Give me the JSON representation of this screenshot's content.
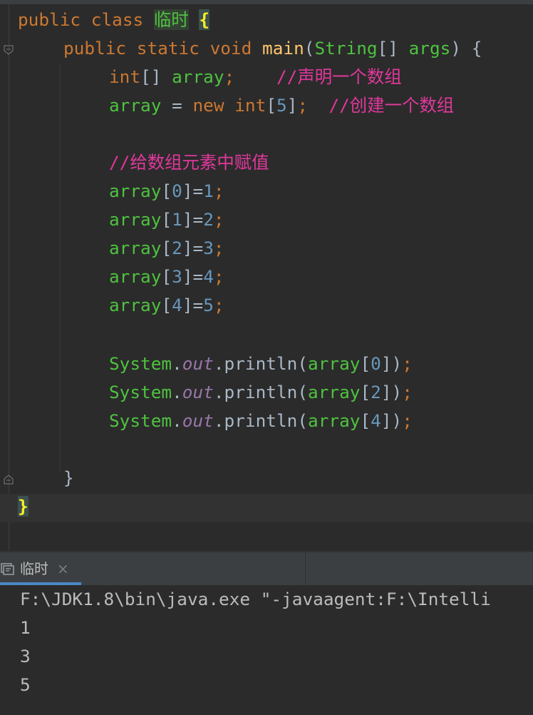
{
  "editor": {
    "line1": {
      "kw": "public class ",
      "class_name": "临时",
      "brace": "{"
    },
    "line2": {
      "modifiers": "public static void ",
      "method": "main",
      "open": "(",
      "param_type": "String",
      "brackets": "[] ",
      "param": "args",
      "close": ") {"
    },
    "line3": {
      "type": "int",
      "brackets": "[] ",
      "var": "array",
      "semi": ";",
      "comment": "//声明一个数组"
    },
    "line4": {
      "var": "array",
      "eq": " = ",
      "kw_new": "new ",
      "type": "int",
      "idx": "5",
      "semi": ";",
      "comment": "//创建一个数组"
    },
    "line6": {
      "comment": "//给数组元素中赋值"
    },
    "assignments": [
      {
        "var": "array",
        "index": "0",
        "value": "1"
      },
      {
        "var": "array",
        "index": "1",
        "value": "2"
      },
      {
        "var": "array",
        "index": "2",
        "value": "3"
      },
      {
        "var": "array",
        "index": "3",
        "value": "4"
      },
      {
        "var": "array",
        "index": "4",
        "value": "5"
      }
    ],
    "prints": [
      {
        "cls": "System",
        "field": "out",
        "method": "println",
        "var": "array",
        "index": "0"
      },
      {
        "cls": "System",
        "field": "out",
        "method": "println",
        "var": "array",
        "index": "2"
      },
      {
        "cls": "System",
        "field": "out",
        "method": "println",
        "var": "array",
        "index": "4"
      }
    ],
    "close_method": "}",
    "close_class": "}"
  },
  "run_panel": {
    "tab_label": "临时",
    "close_symbol": "×",
    "output": [
      "F:\\JDK1.8\\bin\\java.exe \"-javaagent:F:\\Intelli",
      "1",
      "3",
      "5"
    ]
  },
  "colors": {
    "background": "#2b2b2b",
    "keyword": "#cc7832",
    "method": "#ffc66d",
    "variable": "#4ec23f",
    "number": "#6897bb",
    "comment": "#e0389c",
    "field": "#9876aa",
    "tab_accent": "#4a88c7"
  },
  "icons": {
    "fold_markers": [
      "fold-collapse-icon",
      "fold-end-icon"
    ],
    "run_tab": "console-icon"
  }
}
